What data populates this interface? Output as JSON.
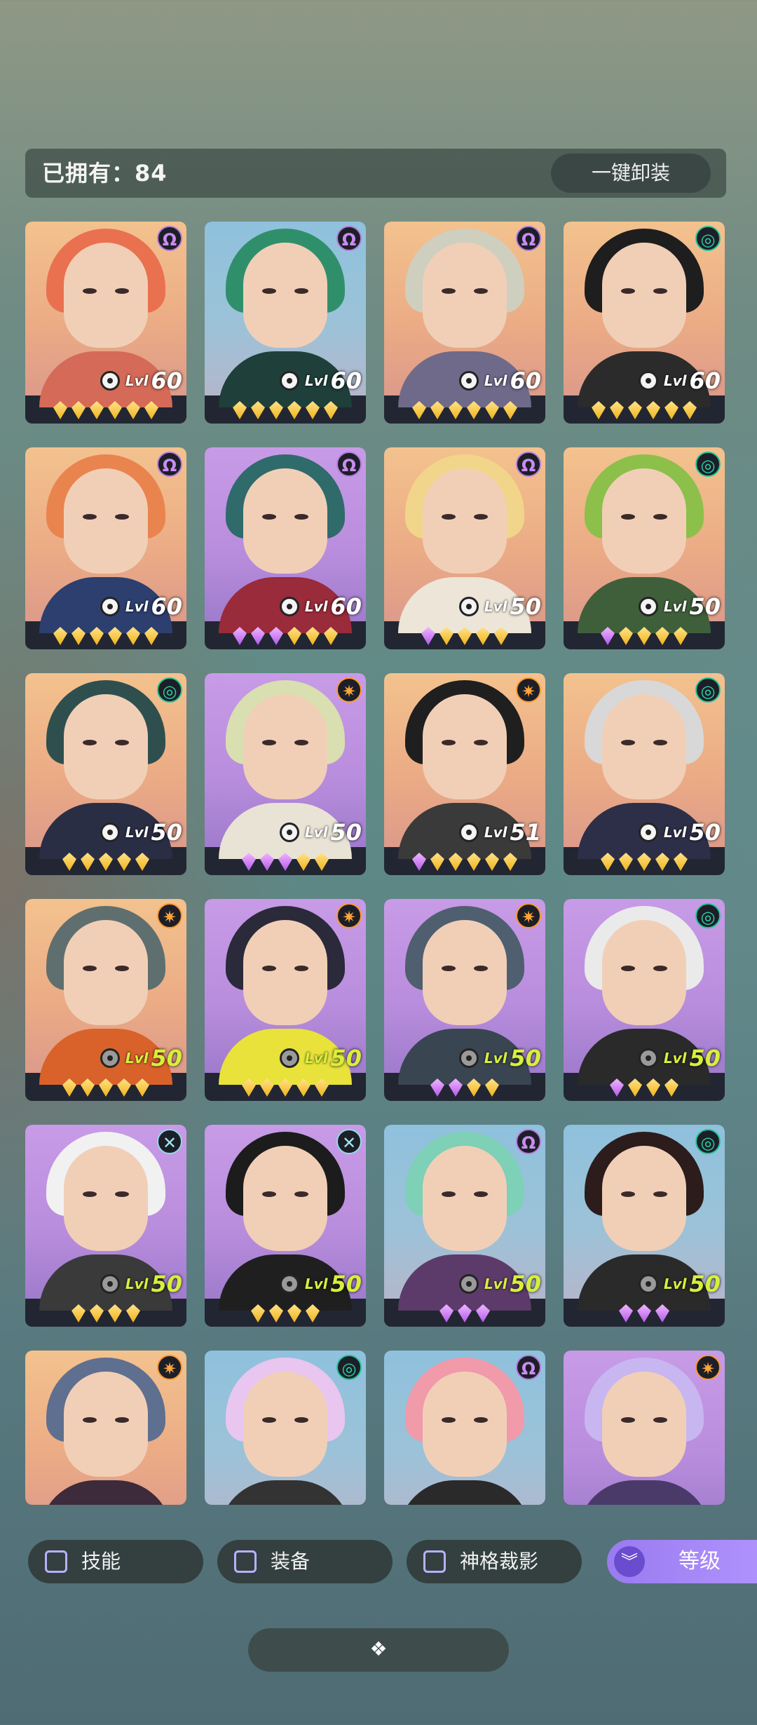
{
  "header": {
    "owned_label": "已拥有：84",
    "unequip_label": "一键卸装"
  },
  "cards": [
    {
      "faction": "purple",
      "bg": "orange",
      "hair": "#e9714f",
      "body": "#d46a57",
      "level_tag": "Lvl",
      "level": "60",
      "level_color": "white",
      "stars": [
        "gold",
        "gold",
        "gold",
        "gold",
        "gold",
        "gold"
      ]
    },
    {
      "faction": "purple",
      "bg": "blue",
      "hair": "#2f8f6b",
      "body": "#1f3f3a",
      "level_tag": "Lvl",
      "level": "60",
      "level_color": "white",
      "stars": [
        "gold",
        "gold",
        "gold",
        "gold",
        "gold",
        "gold"
      ]
    },
    {
      "faction": "purple",
      "bg": "orange",
      "hair": "#cfcfbf",
      "body": "#6f6a8a",
      "level_tag": "Lvl",
      "level": "60",
      "level_color": "white",
      "stars": [
        "gold",
        "gold",
        "gold",
        "gold",
        "gold",
        "gold"
      ]
    },
    {
      "faction": "green",
      "bg": "orange",
      "hair": "#1e1e1e",
      "body": "#2b2b2b",
      "level_tag": "Lvl",
      "level": "60",
      "level_color": "white",
      "stars": [
        "gold",
        "gold",
        "gold",
        "gold",
        "gold",
        "gold"
      ]
    },
    {
      "faction": "purple",
      "bg": "orange",
      "hair": "#e9844f",
      "body": "#2c3f6f",
      "level_tag": "Lvl",
      "level": "60",
      "level_color": "white",
      "stars": [
        "gold",
        "gold",
        "gold",
        "gold",
        "gold",
        "gold"
      ]
    },
    {
      "faction": "purple",
      "bg": "purple",
      "hair": "#2f6b6b",
      "body": "#9a2b3a",
      "level_tag": "Lvl",
      "level": "60",
      "level_color": "white",
      "stars": [
        "purple",
        "purple",
        "purple",
        "gold",
        "gold",
        "gold"
      ]
    },
    {
      "faction": "purple",
      "bg": "orange",
      "hair": "#f1d58a",
      "body": "#ece5d8",
      "level_tag": "Lvl",
      "level": "50",
      "level_color": "white",
      "stars": [
        "purple",
        "gold",
        "gold",
        "gold",
        "gold"
      ]
    },
    {
      "faction": "green",
      "bg": "orange",
      "hair": "#8cc04a",
      "body": "#3f5f3a",
      "level_tag": "Lvl",
      "level": "50",
      "level_color": "white",
      "stars": [
        "purple",
        "gold",
        "gold",
        "gold",
        "gold"
      ]
    },
    {
      "faction": "green",
      "bg": "orange",
      "hair": "#2f4f4f",
      "body": "#2a2e45",
      "level_tag": "Lvl",
      "level": "50",
      "level_color": "white",
      "stars": [
        "gold",
        "gold",
        "gold",
        "gold",
        "gold"
      ]
    },
    {
      "faction": "orange",
      "bg": "purple",
      "hair": "#d9dfb0",
      "body": "#e9e3d6",
      "level_tag": "Lvl",
      "level": "50",
      "level_color": "white",
      "stars": [
        "purple",
        "purple",
        "purple",
        "gold",
        "gold"
      ]
    },
    {
      "faction": "orange",
      "bg": "orange",
      "hair": "#1f1f1f",
      "body": "#3a3a3a",
      "level_tag": "Lvl",
      "level": "51",
      "level_color": "white",
      "stars": [
        "purple",
        "gold",
        "gold",
        "gold",
        "gold",
        "gold"
      ]
    },
    {
      "faction": "green",
      "bg": "orange",
      "hair": "#d8d8d8",
      "body": "#2d2f48",
      "level_tag": "Lvl",
      "level": "50",
      "level_color": "white",
      "stars": [
        "gold",
        "gold",
        "gold",
        "gold",
        "gold"
      ]
    },
    {
      "faction": "orange",
      "bg": "orange",
      "hair": "#5f6f6f",
      "body": "#d9622a",
      "level_tag": "Lvl",
      "level": "50",
      "level_color": "yellow",
      "stars": [
        "gold",
        "gold",
        "gold",
        "gold",
        "gold"
      ]
    },
    {
      "faction": "orange",
      "bg": "purple",
      "hair": "#2a2a3a",
      "body": "#e8e23a",
      "level_tag": "Lvl",
      "level": "50",
      "level_color": "yellow",
      "stars": [
        "gold",
        "gold",
        "gold",
        "gold",
        "gold"
      ]
    },
    {
      "faction": "orange",
      "bg": "purple",
      "hair": "#4f5f6f",
      "body": "#3a4552",
      "level_tag": "Lvl",
      "level": "50",
      "level_color": "yellow",
      "stars": [
        "purple",
        "purple",
        "gold",
        "gold"
      ]
    },
    {
      "faction": "green",
      "bg": "purple",
      "hair": "#eaeaea",
      "body": "#2a2a2a",
      "level_tag": "Lvl",
      "level": "50",
      "level_color": "yellow",
      "stars": [
        "purple",
        "gold",
        "gold",
        "gold"
      ]
    },
    {
      "faction": "cyan",
      "bg": "purple",
      "hair": "#f1f1f1",
      "body": "#3a3a3a",
      "level_tag": "Lvl",
      "level": "50",
      "level_color": "yellow",
      "stars": [
        "gold",
        "gold",
        "gold",
        "gold"
      ]
    },
    {
      "faction": "cyan",
      "bg": "purple",
      "hair": "#1c1c1c",
      "body": "#1f1f1f",
      "level_tag": "Lvl",
      "level": "50",
      "level_color": "yellow",
      "stars": [
        "gold",
        "gold",
        "gold",
        "gold"
      ]
    },
    {
      "faction": "purple",
      "bg": "blue",
      "hair": "#7ed0b6",
      "body": "#5c3b6a",
      "level_tag": "Lvl",
      "level": "50",
      "level_color": "yellow",
      "stars": [
        "purple",
        "purple",
        "purple"
      ]
    },
    {
      "faction": "green",
      "bg": "blue",
      "hair": "#2c1c1c",
      "body": "#2a2a2a",
      "level_tag": "Lvl",
      "level": "50",
      "level_color": "yellow",
      "stars": [
        "purple",
        "purple",
        "purple"
      ]
    },
    {
      "faction": "orange",
      "bg": "orange",
      "hair": "#5f6f8f",
      "body": "#3d2a3a",
      "level_tag": "",
      "level": "",
      "level_color": "white",
      "stars": []
    },
    {
      "faction": "green",
      "bg": "blue",
      "hair": "#e8c6ef",
      "body": "#333333",
      "level_tag": "",
      "level": "",
      "level_color": "white",
      "stars": []
    },
    {
      "faction": "purple",
      "bg": "blue",
      "hair": "#f09aaa",
      "body": "#2a2a2a",
      "level_tag": "",
      "level": "",
      "level_color": "white",
      "stars": []
    },
    {
      "faction": "orange",
      "bg": "purple",
      "hair": "#c8b6f0",
      "body": "#4a3a6a",
      "level_tag": "",
      "level": "",
      "level_color": "white",
      "stars": []
    }
  ],
  "filters": [
    {
      "label": "技能"
    },
    {
      "label": "装备"
    },
    {
      "label": "神格裁影"
    }
  ],
  "level_sort": {
    "label": "等级",
    "icon": "double-chevron-down-icon"
  },
  "collapse": {
    "icon": "diamond-cluster-icon"
  }
}
